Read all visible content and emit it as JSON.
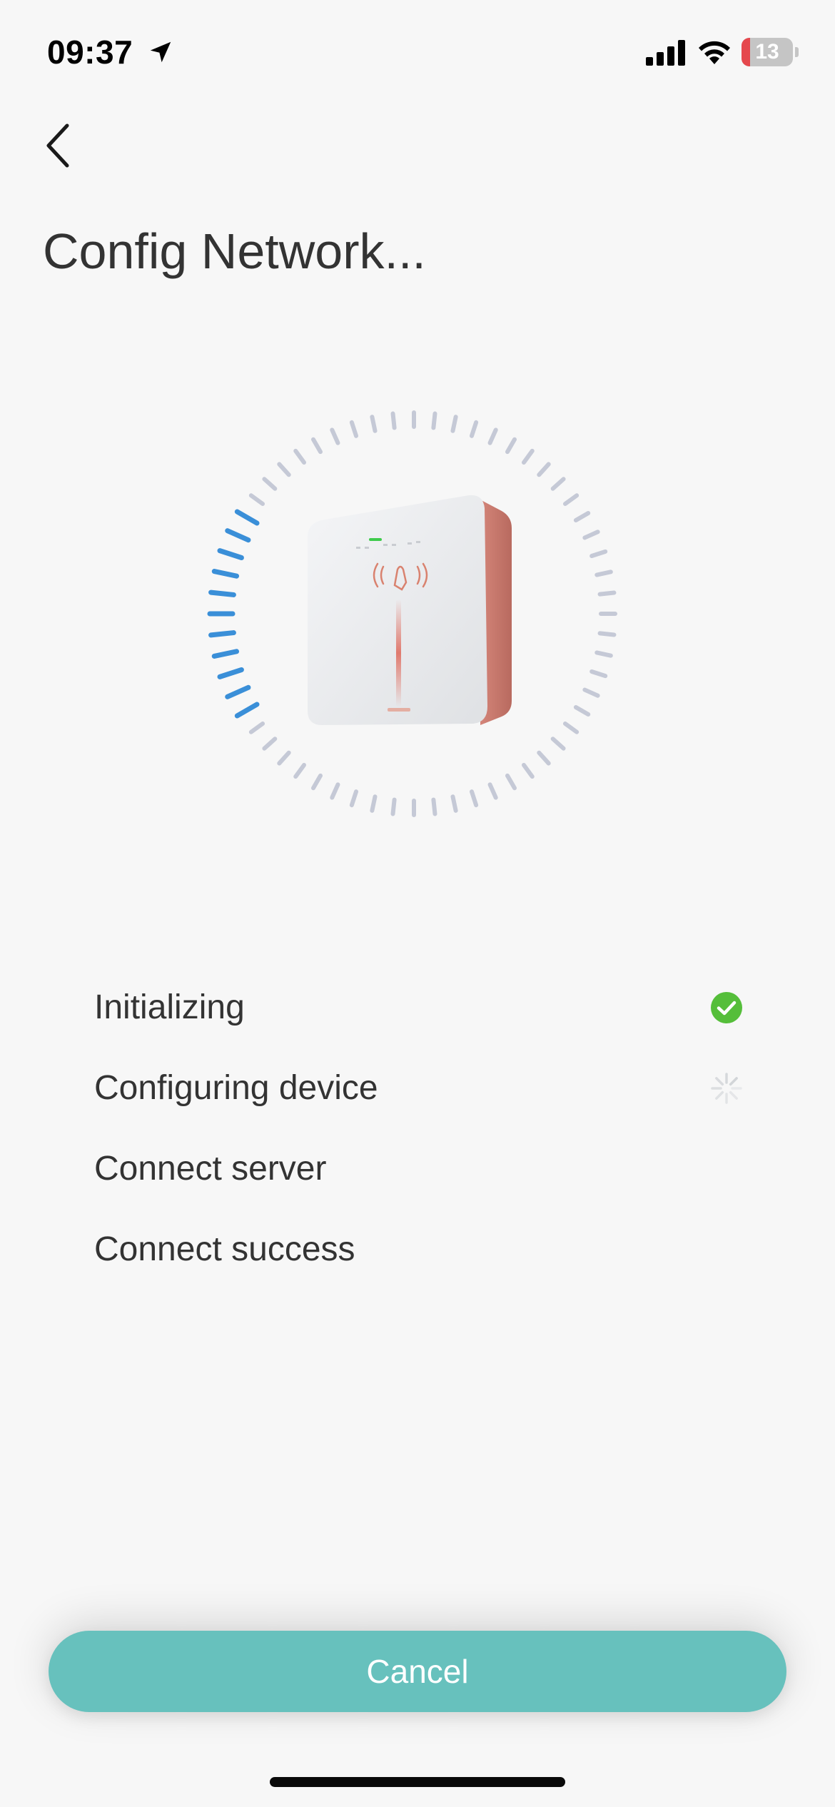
{
  "status_bar": {
    "time": "09:37",
    "battery_level": "13",
    "icons": [
      "location-arrow-icon",
      "cellular-signal-icon",
      "wifi-icon",
      "battery-icon"
    ]
  },
  "nav": {
    "back_icon": "chevron-left-icon",
    "title": "Config Network..."
  },
  "illustration": {
    "device_icon": "ev-charger-device",
    "progress_ring_colors": {
      "active": "#3a8fd8",
      "inactive": "#c5c9d6"
    }
  },
  "steps": [
    {
      "label": "Initializing",
      "state": "done",
      "icon": "check-circle-icon"
    },
    {
      "label": "Configuring device",
      "state": "in-progress",
      "icon": "spinner-icon"
    },
    {
      "label": "Connect server",
      "state": "pending"
    },
    {
      "label": "Connect success",
      "state": "pending"
    }
  ],
  "actions": {
    "cancel_label": "Cancel"
  },
  "colors": {
    "accent": "#67c1bd",
    "success": "#55be3a",
    "background": "#f7f7f7"
  }
}
